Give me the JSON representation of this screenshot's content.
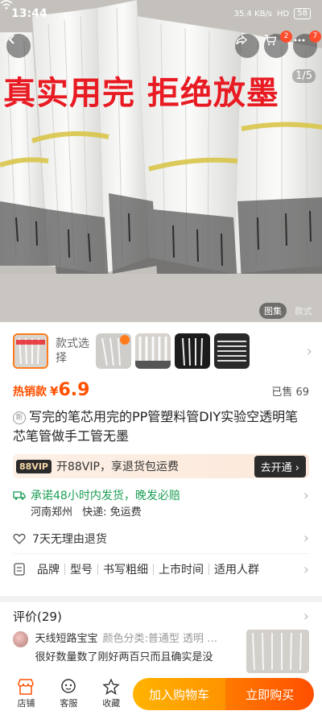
{
  "status": {
    "time": "13:44",
    "net": "35.4 KB/s",
    "signal": "HD",
    "battery": "58"
  },
  "hero": {
    "overlay_text": "真实用完 拒绝放墨",
    "pager": "1/5",
    "tabs": [
      "图集",
      "款式"
    ],
    "cart_badge": "2",
    "more_badge": "7"
  },
  "sku": {
    "label": "款式选择"
  },
  "price": {
    "hot_label": "热销款",
    "currency": "¥",
    "value": "6.9",
    "sold": "已售 69"
  },
  "product": {
    "new_tag": "新",
    "title": "写完的笔芯用完的PP管塑料管DIY实验空透明笔芯笔管做手工管无墨"
  },
  "vip": {
    "chip": "88VIP",
    "text": "开88VIP，享退货包运费",
    "button": "去开通 ›"
  },
  "shipping": {
    "promise": "承诺48小时内发货，晚发必赔",
    "origin": "河南郑州",
    "fee": "快递: 免运费"
  },
  "service": {
    "return_policy": "7天无理由退货",
    "attributes": [
      "品牌",
      "型号",
      "书写粗细",
      "上市时间",
      "适用人群"
    ]
  },
  "review": {
    "title": "评价(29)",
    "user": "天线短路宝宝",
    "meta": "颜色分类:普通型 透明 …",
    "text": "很好数量数了刚好两百只而且确实是没"
  },
  "bottom": {
    "shop": "店铺",
    "service": "客服",
    "favorite": "收藏",
    "add_cart": "加入购物车",
    "buy_now": "立即购买"
  },
  "colors": {
    "accent": "#ff5000",
    "overlay_red": "#e81b23",
    "green": "#1a9e54"
  }
}
